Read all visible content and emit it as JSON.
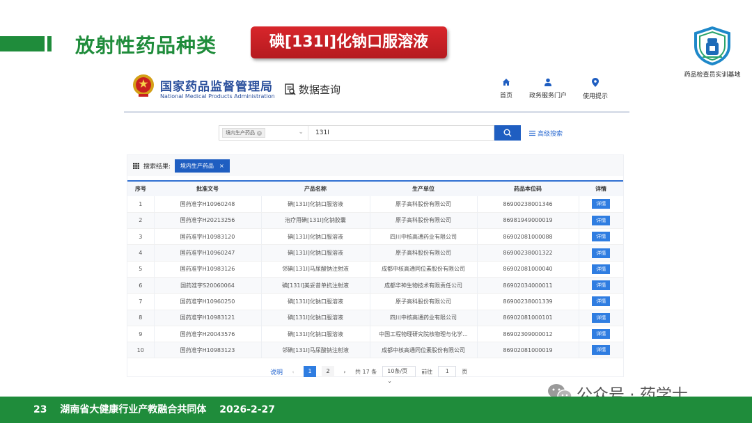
{
  "slide": {
    "title": "放射性药品种类",
    "badge": "碘[131I]化钠口服溶液",
    "logo_text": "药品检查员实训基地"
  },
  "site": {
    "name": "国家药品监督管理局",
    "name_en": "National Medical Products Administration",
    "data_query": "数据查询",
    "nav": [
      {
        "label": "首页",
        "icon": "home-icon"
      },
      {
        "label": "政务服务门户",
        "icon": "user-icon"
      },
      {
        "label": "使用提示",
        "icon": "pin-icon"
      }
    ]
  },
  "search": {
    "category_chip": "境内生产药品",
    "query": "131I",
    "advanced_label": "高级搜索"
  },
  "results": {
    "label": "搜索结果:",
    "active_tag": "境内生产药品",
    "columns": [
      "序号",
      "批准文号",
      "产品名称",
      "生产单位",
      "药品本位码",
      "详情"
    ],
    "detail_label": "详情",
    "rows": [
      [
        "1",
        "国药准字H10960248",
        "碘[131I]化钠口服溶液",
        "原子高科股份有限公司",
        "86900238001346"
      ],
      [
        "2",
        "国药准字H20213256",
        "治疗用碘[131I]化钠胶囊",
        "原子高科股份有限公司",
        "86981949000019"
      ],
      [
        "3",
        "国药准字H10983120",
        "碘[131I]化钠口服溶液",
        "四川中核高通药业有限公司",
        "86902081000088"
      ],
      [
        "4",
        "国药准字H10960247",
        "碘[131I]化钠口服溶液",
        "原子高科股份有限公司",
        "86900238001322"
      ],
      [
        "5",
        "国药准字H10983126",
        "邻碘[131I]马尿酸钠注射液",
        "成都中核高通同位素股份有限公司",
        "86902081000040"
      ],
      [
        "6",
        "国药准字S20060064",
        "碘[131I]美妥昔单抗注射液",
        "成都华神生物技术有限责任公司",
        "86902034000011"
      ],
      [
        "7",
        "国药准字H10960250",
        "碘[131I]化钠口服溶液",
        "原子高科股份有限公司",
        "86900238001339"
      ],
      [
        "8",
        "国药准字H10983121",
        "碘[131I]化钠口服溶液",
        "四川中核高通药业有限公司",
        "86902081000101"
      ],
      [
        "9",
        "国药准字H20043576",
        "碘[131I]化钠口服溶液",
        "中国工程物理研究院核物理与化学...",
        "86902309000012"
      ],
      [
        "10",
        "国药准字H10983123",
        "邻碘[131I]马尿酸钠注射液",
        "成都中核高通同位素股份有限公司",
        "86902081000019"
      ]
    ]
  },
  "pagination": {
    "help": "说明",
    "pages": [
      "1",
      "2"
    ],
    "total": "共 17 条",
    "page_size": "10条/页",
    "goto_label": "前往",
    "goto_value": "1",
    "page_unit": "页"
  },
  "watermark": "公众号 · 药学士",
  "footer": {
    "page_number": "23",
    "org": "湖南省大健康行业产教融合共同体",
    "date": "2026-2-27"
  },
  "colors": {
    "green": "#1f8c3b",
    "red": "#c8201f",
    "blue": "#1f5ec1"
  }
}
